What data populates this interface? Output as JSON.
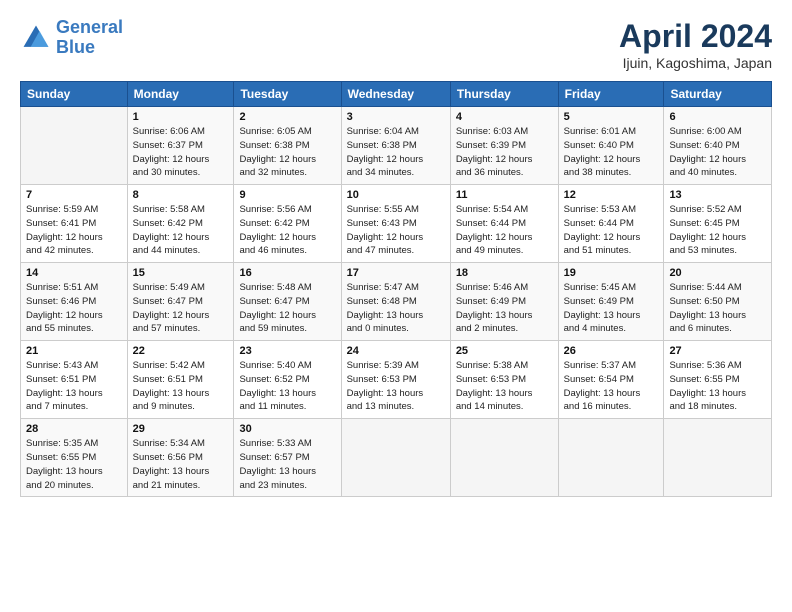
{
  "header": {
    "logo_line1": "General",
    "logo_line2": "Blue",
    "title": "April 2024",
    "subtitle": "Ijuin, Kagoshima, Japan"
  },
  "weekdays": [
    "Sunday",
    "Monday",
    "Tuesday",
    "Wednesday",
    "Thursday",
    "Friday",
    "Saturday"
  ],
  "weeks": [
    [
      {
        "day": "",
        "info": ""
      },
      {
        "day": "1",
        "info": "Sunrise: 6:06 AM\nSunset: 6:37 PM\nDaylight: 12 hours\nand 30 minutes."
      },
      {
        "day": "2",
        "info": "Sunrise: 6:05 AM\nSunset: 6:38 PM\nDaylight: 12 hours\nand 32 minutes."
      },
      {
        "day": "3",
        "info": "Sunrise: 6:04 AM\nSunset: 6:38 PM\nDaylight: 12 hours\nand 34 minutes."
      },
      {
        "day": "4",
        "info": "Sunrise: 6:03 AM\nSunset: 6:39 PM\nDaylight: 12 hours\nand 36 minutes."
      },
      {
        "day": "5",
        "info": "Sunrise: 6:01 AM\nSunset: 6:40 PM\nDaylight: 12 hours\nand 38 minutes."
      },
      {
        "day": "6",
        "info": "Sunrise: 6:00 AM\nSunset: 6:40 PM\nDaylight: 12 hours\nand 40 minutes."
      }
    ],
    [
      {
        "day": "7",
        "info": "Sunrise: 5:59 AM\nSunset: 6:41 PM\nDaylight: 12 hours\nand 42 minutes."
      },
      {
        "day": "8",
        "info": "Sunrise: 5:58 AM\nSunset: 6:42 PM\nDaylight: 12 hours\nand 44 minutes."
      },
      {
        "day": "9",
        "info": "Sunrise: 5:56 AM\nSunset: 6:42 PM\nDaylight: 12 hours\nand 46 minutes."
      },
      {
        "day": "10",
        "info": "Sunrise: 5:55 AM\nSunset: 6:43 PM\nDaylight: 12 hours\nand 47 minutes."
      },
      {
        "day": "11",
        "info": "Sunrise: 5:54 AM\nSunset: 6:44 PM\nDaylight: 12 hours\nand 49 minutes."
      },
      {
        "day": "12",
        "info": "Sunrise: 5:53 AM\nSunset: 6:44 PM\nDaylight: 12 hours\nand 51 minutes."
      },
      {
        "day": "13",
        "info": "Sunrise: 5:52 AM\nSunset: 6:45 PM\nDaylight: 12 hours\nand 53 minutes."
      }
    ],
    [
      {
        "day": "14",
        "info": "Sunrise: 5:51 AM\nSunset: 6:46 PM\nDaylight: 12 hours\nand 55 minutes."
      },
      {
        "day": "15",
        "info": "Sunrise: 5:49 AM\nSunset: 6:47 PM\nDaylight: 12 hours\nand 57 minutes."
      },
      {
        "day": "16",
        "info": "Sunrise: 5:48 AM\nSunset: 6:47 PM\nDaylight: 12 hours\nand 59 minutes."
      },
      {
        "day": "17",
        "info": "Sunrise: 5:47 AM\nSunset: 6:48 PM\nDaylight: 13 hours\nand 0 minutes."
      },
      {
        "day": "18",
        "info": "Sunrise: 5:46 AM\nSunset: 6:49 PM\nDaylight: 13 hours\nand 2 minutes."
      },
      {
        "day": "19",
        "info": "Sunrise: 5:45 AM\nSunset: 6:49 PM\nDaylight: 13 hours\nand 4 minutes."
      },
      {
        "day": "20",
        "info": "Sunrise: 5:44 AM\nSunset: 6:50 PM\nDaylight: 13 hours\nand 6 minutes."
      }
    ],
    [
      {
        "day": "21",
        "info": "Sunrise: 5:43 AM\nSunset: 6:51 PM\nDaylight: 13 hours\nand 7 minutes."
      },
      {
        "day": "22",
        "info": "Sunrise: 5:42 AM\nSunset: 6:51 PM\nDaylight: 13 hours\nand 9 minutes."
      },
      {
        "day": "23",
        "info": "Sunrise: 5:40 AM\nSunset: 6:52 PM\nDaylight: 13 hours\nand 11 minutes."
      },
      {
        "day": "24",
        "info": "Sunrise: 5:39 AM\nSunset: 6:53 PM\nDaylight: 13 hours\nand 13 minutes."
      },
      {
        "day": "25",
        "info": "Sunrise: 5:38 AM\nSunset: 6:53 PM\nDaylight: 13 hours\nand 14 minutes."
      },
      {
        "day": "26",
        "info": "Sunrise: 5:37 AM\nSunset: 6:54 PM\nDaylight: 13 hours\nand 16 minutes."
      },
      {
        "day": "27",
        "info": "Sunrise: 5:36 AM\nSunset: 6:55 PM\nDaylight: 13 hours\nand 18 minutes."
      }
    ],
    [
      {
        "day": "28",
        "info": "Sunrise: 5:35 AM\nSunset: 6:55 PM\nDaylight: 13 hours\nand 20 minutes."
      },
      {
        "day": "29",
        "info": "Sunrise: 5:34 AM\nSunset: 6:56 PM\nDaylight: 13 hours\nand 21 minutes."
      },
      {
        "day": "30",
        "info": "Sunrise: 5:33 AM\nSunset: 6:57 PM\nDaylight: 13 hours\nand 23 minutes."
      },
      {
        "day": "",
        "info": ""
      },
      {
        "day": "",
        "info": ""
      },
      {
        "day": "",
        "info": ""
      },
      {
        "day": "",
        "info": ""
      }
    ]
  ]
}
